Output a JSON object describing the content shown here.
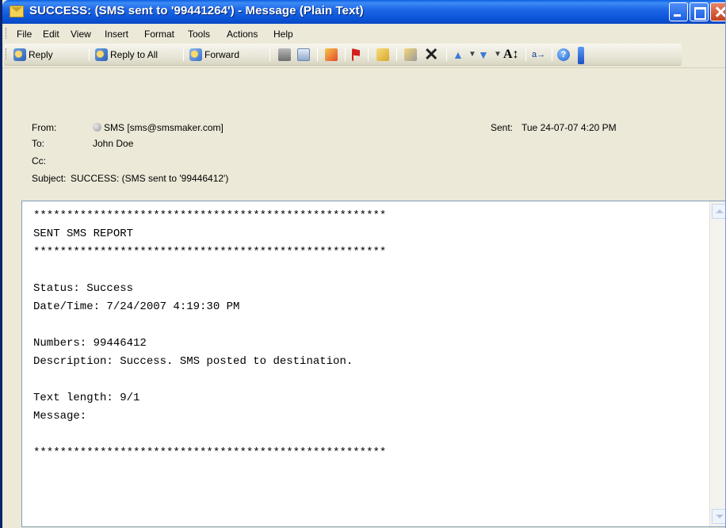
{
  "window": {
    "title": "SUCCESS: (SMS sent to '99441264') - Message (Plain Text)"
  },
  "menu": [
    "File",
    "Edit",
    "View",
    "Insert",
    "Format",
    "Tools",
    "Actions",
    "Help"
  ],
  "toolbar": {
    "reply": "Reply",
    "reply_all": "Reply to All",
    "forward": "Forward",
    "font_size_glyph": "A↕",
    "translate_glyph": "a→"
  },
  "header": {
    "from_label": "From:",
    "from_value": "SMS [sms@smsmaker.com]",
    "to_label": "To:",
    "to_value": "John Doe",
    "cc_label": "Cc:",
    "cc_value": "",
    "subject_label": "Subject:",
    "subject_value": "SUCCESS:  (SMS sent to '99446412')",
    "sent_label": "Sent:",
    "sent_value": "Tue 24-07-07 4:20 PM"
  },
  "body": {
    "stars": "*****************************************************",
    "report_title": "SENT SMS REPORT",
    "status_line": "Status: Success",
    "datetime_line": "Date/Time: 7/24/2007 4:19:30 PM",
    "numbers_line": "Numbers: 99446412",
    "description_line": "Description: Success. SMS posted to destination.",
    "text_length_line": "Text length: 9/1",
    "message_line": "Message:"
  },
  "colors": {
    "titlebar": "#0b55d9",
    "header_bg": "#ece9d8",
    "body_border": "#7f9db9"
  }
}
